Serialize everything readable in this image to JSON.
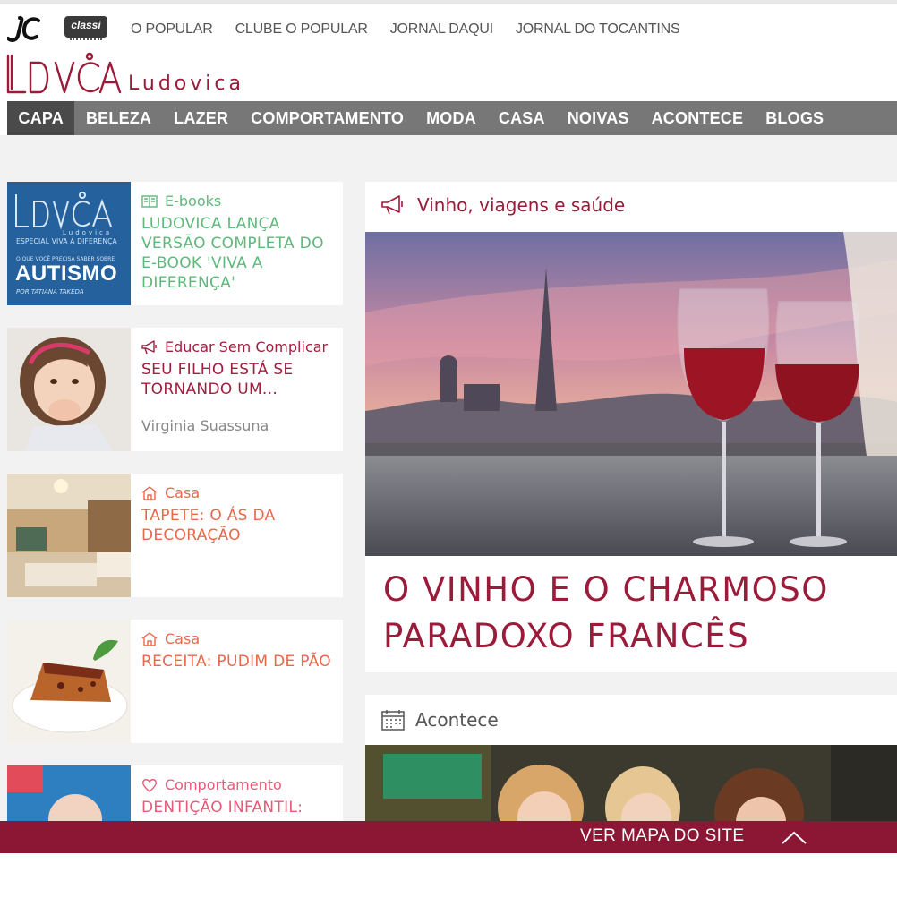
{
  "topbar": {
    "logos": {
      "jc": "JC",
      "classi": "classi"
    },
    "links": [
      "O POPULAR",
      "CLUBE O POPULAR",
      "JORNAL DAQUI",
      "JORNAL DO TOCANTINS"
    ]
  },
  "brand": {
    "mark": "LDVCA",
    "name": "Ludovica"
  },
  "nav": {
    "items": [
      "CAPA",
      "BELEZA",
      "LAZER",
      "COMPORTAMENTO",
      "MODA",
      "CASA",
      "NOIVAS",
      "ACONTECE",
      "BLOGS"
    ],
    "active": "CAPA"
  },
  "cards": [
    {
      "category": "E-books",
      "title": "LUDOVICA LANÇA VERSÃO COMPLETA DO E-BOOK 'VIVA A DIFERENÇA'",
      "author": "",
      "icon": "book-icon",
      "color": "#5fb87a",
      "thumb": {
        "mark": "LDVCA",
        "sub": "Ludovica",
        "special": "ESPECIAL VIVA A DIFERENÇA",
        "pre": "O QUE VOCÊ PRECISA SABER SOBRE",
        "big": "AUTISMO",
        "by": "POR TATIANA TAKEDA"
      }
    },
    {
      "category": "Educar Sem Complicar",
      "title": "SEU FILHO ESTÁ SE TORNANDO UM...",
      "author": "Virginia Suassuna",
      "icon": "megaphone-icon",
      "color": "#a01e3e"
    },
    {
      "category": "Casa",
      "title": "TAPETE: O ÁS DA DECORAÇÃO",
      "author": "",
      "icon": "home-icon",
      "color": "#e8684a"
    },
    {
      "category": "Casa",
      "title": "RECEITA: PUDIM DE PÃO",
      "author": "",
      "icon": "home-icon",
      "color": "#e8684a"
    },
    {
      "category": "Comportamento",
      "title": "DENTIÇÃO INFANTIL:",
      "author": "",
      "icon": "heart-icon",
      "color": "#e85a78"
    }
  ],
  "feature": {
    "category": "Vinho, viagens e saúde",
    "headline": "O VINHO E O CHARMOSO PARADOXO FRANCÊS"
  },
  "feature2": {
    "category": "Acontece"
  },
  "footer": {
    "sitemap": "VER MAPA DO SITE"
  },
  "colors": {
    "brand": "#9a1c3a",
    "nav_bg": "#777777",
    "nav_active": "#4a4a4a",
    "footer_bg": "#8b1734"
  }
}
